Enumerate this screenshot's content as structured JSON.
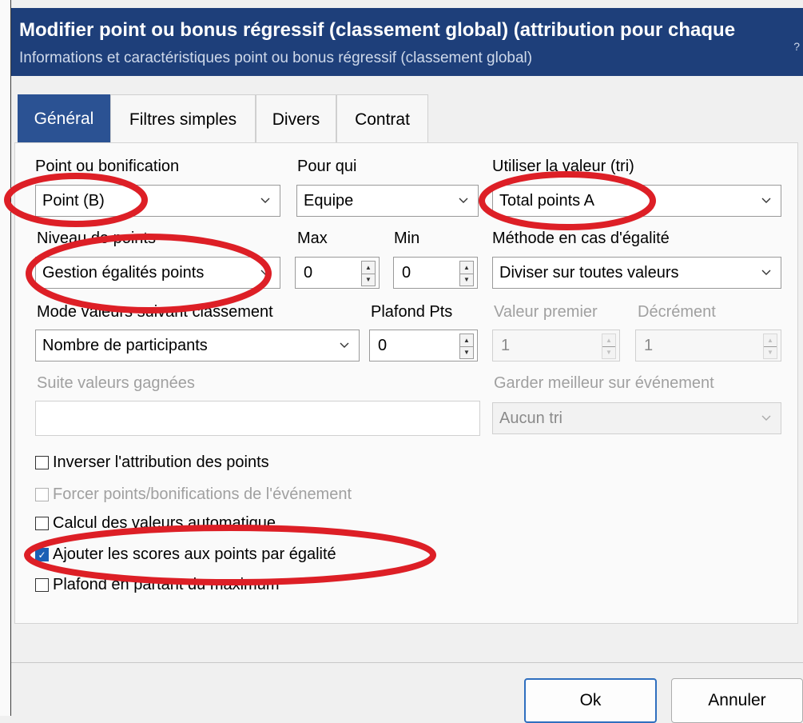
{
  "window": {
    "title": "Modifier point ou bonus régressif (classement global) (attribution pour chaque",
    "subtitle": "Informations et caractéristiques point ou bonus régressif (classement global)",
    "help_glyph": "?"
  },
  "tabs": [
    {
      "label": "Général",
      "active": true
    },
    {
      "label": "Filtres simples",
      "active": false
    },
    {
      "label": "Divers",
      "active": false
    },
    {
      "label": "Contrat",
      "active": false
    }
  ],
  "form": {
    "point_ou_bonification": {
      "label": "Point ou bonification",
      "value": "Point (B)"
    },
    "pour_qui": {
      "label": "Pour qui",
      "value": "Equipe"
    },
    "utiliser_valeur": {
      "label": "Utiliser la valeur (tri)",
      "value": "Total points A"
    },
    "niveau_points": {
      "label": "Niveau de points",
      "value": "Gestion égalités points"
    },
    "max": {
      "label": "Max",
      "value": "0"
    },
    "min": {
      "label": "Min",
      "value": "0"
    },
    "methode_egalite": {
      "label": "Méthode en cas d'égalité",
      "value": "Diviser sur toutes valeurs"
    },
    "mode_valeurs": {
      "label": "Mode valeurs suivant classement",
      "value": "Nombre de participants"
    },
    "plafond_pts": {
      "label": "Plafond Pts",
      "value": "0"
    },
    "valeur_premier": {
      "label": "Valeur premier",
      "value": "1"
    },
    "decrement": {
      "label": "Décrément",
      "value": "1"
    },
    "suite_valeurs": {
      "label": "Suite valeurs gagnées",
      "value": ""
    },
    "garder_meilleur": {
      "label": "Garder meilleur sur événement",
      "value": "Aucun tri"
    }
  },
  "checkboxes": [
    {
      "label": "Inverser l'attribution des points",
      "checked": false,
      "enabled": true
    },
    {
      "label": "Forcer points/bonifications de l'événement",
      "checked": false,
      "enabled": false
    },
    {
      "label": "Calcul des valeurs automatique",
      "checked": false,
      "enabled": true
    },
    {
      "label": "Ajouter les scores aux points par égalité",
      "checked": true,
      "enabled": true
    },
    {
      "label": "Plafond en partant du maximum",
      "checked": false,
      "enabled": true
    }
  ],
  "buttons": {
    "ok": "Ok",
    "cancel": "Annuler"
  },
  "colors": {
    "title_bar": "#1e3f7a",
    "active_tab": "#2b5293",
    "annotation": "#dd1f26",
    "check_accent": "#1a5fb4"
  },
  "check_glyph": "✓"
}
